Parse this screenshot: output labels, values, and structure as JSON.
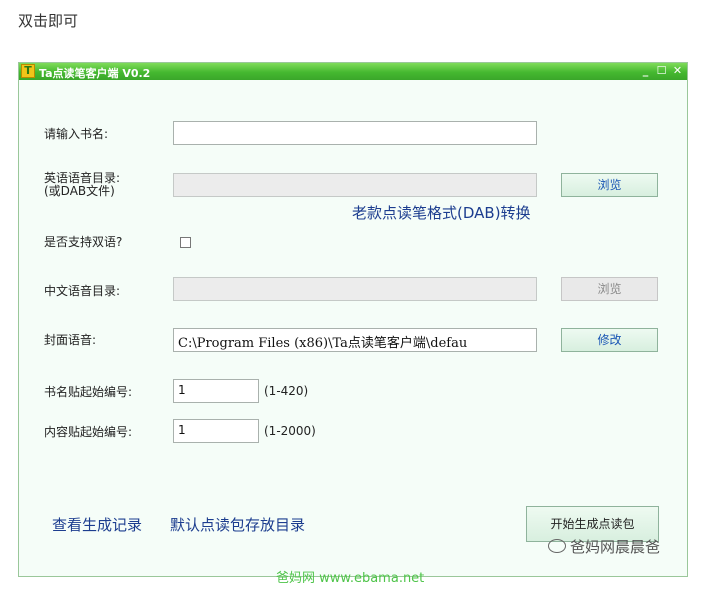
{
  "caption": "双击即可",
  "window": {
    "title": "Ta点读笔客户端 V0.2",
    "logo_letter": "T",
    "controls": {
      "minimize": "_",
      "maximize": "☐",
      "close": "✕"
    }
  },
  "form": {
    "book_name_label": "请输入书名:",
    "book_name_value": "",
    "english_dir_label_line1": "英语语音目录:",
    "english_dir_label_line2": "(或DAB文件)",
    "english_dir_value": "",
    "english_browse_button": "浏览",
    "dab_convert_link": "老款点读笔格式(DAB)转换",
    "bilingual_label": "是否支持双语?",
    "bilingual_checked": false,
    "chinese_dir_label": "中文语音目录:",
    "chinese_dir_value": "",
    "chinese_browse_button": "浏览",
    "cover_audio_label": "封面语音:",
    "cover_audio_value": "C:\\Program Files (x86)\\Ta点读笔客户端\\defau",
    "cover_modify_button": "修改",
    "book_sticker_label": "书名贴起始编号:",
    "book_sticker_value": "1",
    "book_sticker_range": "(1-420)",
    "content_sticker_label": "内容贴起始编号:",
    "content_sticker_value": "1",
    "content_sticker_range": "(1-2000)"
  },
  "bottom": {
    "view_log_link": "查看生成记录",
    "default_dir_link": "默认点读包存放目录",
    "generate_button": "开始生成点读包"
  },
  "overlay": {
    "watermark": "爸妈网晨晨爸",
    "site_url": "爸妈网 www.ebama.net"
  }
}
